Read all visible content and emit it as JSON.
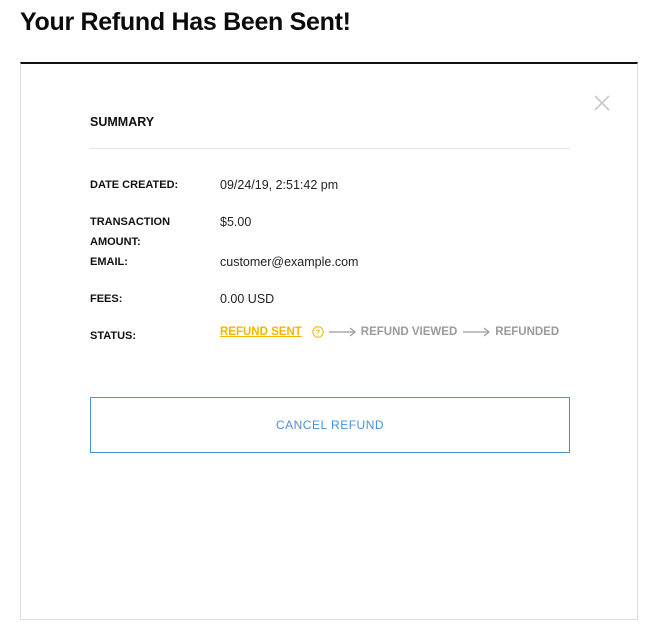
{
  "page": {
    "title": "Your Refund Has Been Sent!"
  },
  "summary": {
    "title": "SUMMARY",
    "close_icon": "close-icon",
    "rows": {
      "date_created": {
        "label": "DATE CREATED:",
        "value": "09/24/19, 2:51:42 pm"
      },
      "transaction_amount": {
        "label_line1": "TRANSACTION",
        "label_line2": "AMOUNT:",
        "value": "$5.00"
      },
      "email": {
        "label": "EMAIL:",
        "value": "customer@example.com"
      },
      "fees": {
        "label": "FEES:",
        "value": "0.00 USD"
      },
      "status": {
        "label": "STATUS:",
        "steps": [
          "REFUND SENT",
          "REFUND VIEWED",
          "REFUNDED"
        ],
        "active_index": 0,
        "info_icon": "info-circle-icon",
        "arrow_icon": "arrow-right-icon"
      }
    },
    "cancel_button_label": "CANCEL REFUND"
  },
  "colors": {
    "accent_blue": "#4a90d9",
    "active_step": "#f4b400",
    "inactive_step": "#9b9b9b"
  }
}
